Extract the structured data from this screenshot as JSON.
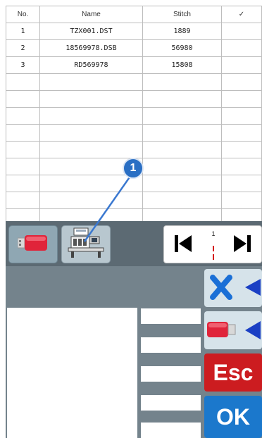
{
  "table": {
    "headers": [
      "No.",
      "Name",
      "Stitch",
      "✓"
    ],
    "rows": [
      {
        "no": "1",
        "name": "TZX001.DST",
        "stitch": "1889",
        "check": ""
      },
      {
        "no": "2",
        "name": "18569978.DSB",
        "stitch": "56980",
        "check": ""
      },
      {
        "no": "3",
        "name": "RD569978",
        "stitch": "15808",
        "check": ""
      },
      {
        "no": "",
        "name": "",
        "stitch": "",
        "check": ""
      },
      {
        "no": "",
        "name": "",
        "stitch": "",
        "check": ""
      },
      {
        "no": "",
        "name": "",
        "stitch": "",
        "check": ""
      },
      {
        "no": "",
        "name": "",
        "stitch": "",
        "check": ""
      },
      {
        "no": "",
        "name": "",
        "stitch": "",
        "check": ""
      },
      {
        "no": "",
        "name": "",
        "stitch": "",
        "check": ""
      },
      {
        "no": "",
        "name": "",
        "stitch": "",
        "check": ""
      },
      {
        "no": "",
        "name": "",
        "stitch": "",
        "check": ""
      },
      {
        "no": "",
        "name": "",
        "stitch": "",
        "check": ""
      }
    ]
  },
  "pager": {
    "page": "1"
  },
  "buttons": {
    "esc": "Esc",
    "ok": "OK"
  },
  "annotation": {
    "label": "1"
  },
  "colors": {
    "panel_dark": "#5c6a73",
    "panel": "#74838c",
    "esc": "#cc1c20",
    "ok": "#1b78cc",
    "accent_blue": "#1a6fd6",
    "usb_red": "#e0243a"
  },
  "icons": [
    "usb-drive-icon",
    "embroidery-machine-icon",
    "first-page-icon",
    "last-page-icon",
    "delete-icon",
    "usb-import-icon"
  ]
}
